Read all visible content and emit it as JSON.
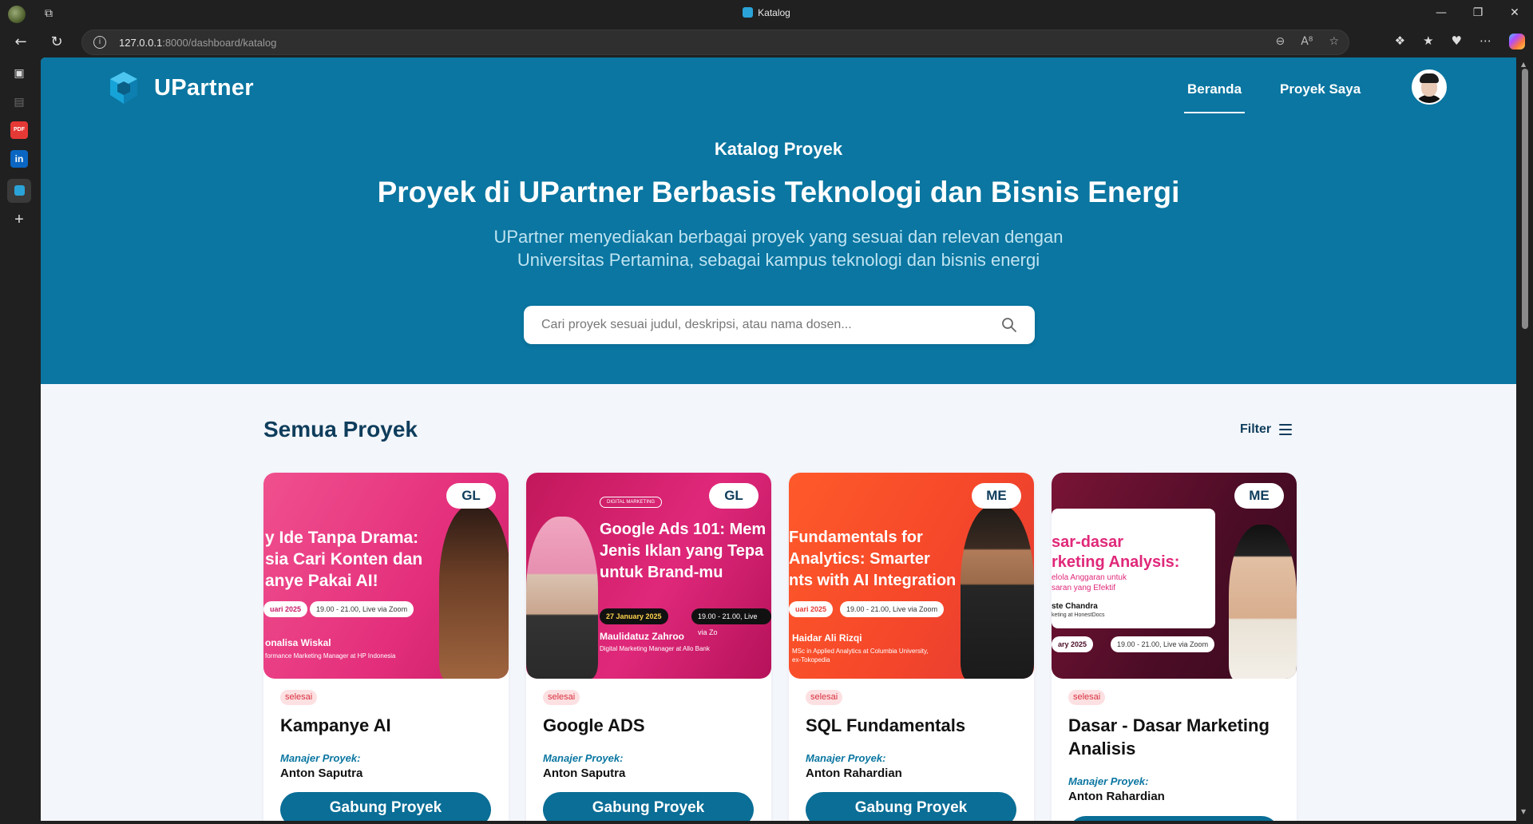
{
  "browser": {
    "tab_title": "Katalog",
    "url_host": "127.0.0.1",
    "url_rest": ":8000/dashboard/katalog"
  },
  "brand": {
    "name": "UPartner",
    "primary_color": "#0a76a1",
    "dark_color": "#0f3d5c"
  },
  "nav": {
    "items": [
      {
        "label": "Beranda",
        "active": true
      },
      {
        "label": "Proyek Saya",
        "active": false
      }
    ]
  },
  "hero": {
    "subtitle": "Katalog Proyek",
    "title": "Proyek di UPartner Berbasis Teknologi dan Bisnis Energi",
    "description": "UPartner menyediakan berbagai proyek yang sesuai dan relevan dengan Universitas Pertamina, sebagai kampus teknologi dan bisnis energi"
  },
  "search": {
    "placeholder": "Cari proyek sesuai judul, deskripsi, atau nama dosen..."
  },
  "section": {
    "title": "Semua Proyek",
    "filter_label": "Filter"
  },
  "manager_label": "Manajer Proyek:",
  "join_label": "Gabung Proyek",
  "projects": [
    {
      "badge": "GL",
      "status": "selesai",
      "title": "Kampanye AI",
      "manager": "Anton Saputra",
      "thumb": {
        "headline": [
          "y Ide Tanpa Drama:",
          "sia Cari Konten dan",
          "anye Pakai AI!"
        ],
        "date": "uari 2025",
        "time": "19.00 - 21.00, Live via Zoom",
        "speaker": "onalisa Wiskal",
        "role": "formance Marketing Manager at HP Indonesia"
      }
    },
    {
      "badge": "GL",
      "status": "selesai",
      "title": "Google ADS",
      "manager": "Anton Saputra",
      "thumb": {
        "tag": "DIGITAL MARKETING",
        "headline": [
          "Google Ads 101: Mem",
          "Jenis Iklan yang Tepa",
          "untuk Brand-mu"
        ],
        "date": "27 January 2025",
        "time": "19.00 - 21.00, Live via Zo",
        "speaker": "Maulidatuz Zahroo",
        "role": "Digital Marketing Manager at Allo Bank"
      }
    },
    {
      "badge": "ME",
      "status": "selesai",
      "title": "SQL Fundamentals",
      "manager": "Anton Rahardian",
      "thumb": {
        "headline": [
          "Fundamentals for",
          "Analytics: Smarter",
          "nts with AI Integration"
        ],
        "date": "uari 2025",
        "time": "19.00 - 21.00, Live via Zoom",
        "speaker": "Haidar Ali Rizqi",
        "role": "MSc in Applied Analytics at Columbia University, ex-Tokopedia"
      }
    },
    {
      "badge": "ME",
      "status": "selesai",
      "title": "Dasar - Dasar Marketing Analisis",
      "manager": "Anton Rahardian",
      "thumb": {
        "headline": [
          "sar-dasar",
          "rketing Analysis:"
        ],
        "small": [
          "elola Anggaran untuk",
          "saran yang Efektif"
        ],
        "speaker": "ste Chandra",
        "role": "keting at HonestDocs",
        "date": "ary 2025",
        "time": "19.00 - 21.00, Live via Zoom"
      }
    }
  ]
}
